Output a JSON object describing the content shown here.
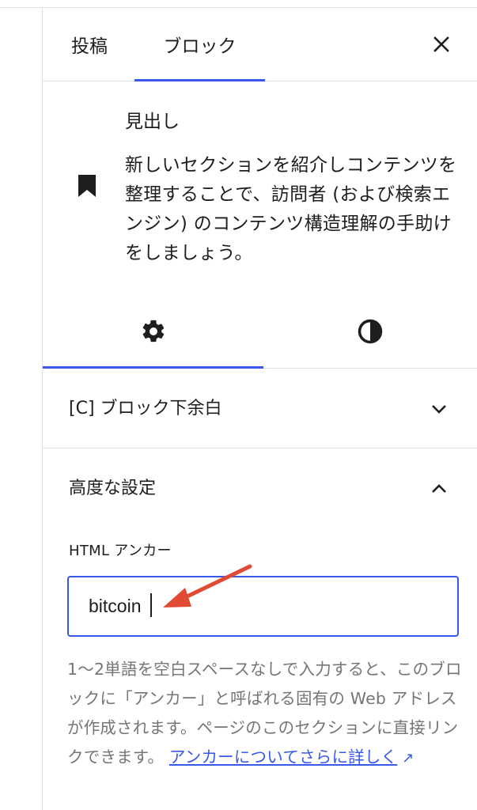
{
  "tabs": {
    "post_label": "投稿",
    "block_label": "ブロック",
    "close_icon": "close-icon"
  },
  "block": {
    "icon": "bookmark-icon",
    "title": "見出し",
    "description": "新しいセクションを紹介しコンテンツを整理することで、訪問者 (および検索エンジン) のコンテンツ構造理解の手助けをしましょう。"
  },
  "subtabs": {
    "settings_icon": "gear-icon",
    "styles_icon": "contrast-icon"
  },
  "sections": {
    "margin_label": "[C] ブロック下余白",
    "margin_state": "collapsed",
    "advanced_label": "高度な設定",
    "advanced_state": "expanded"
  },
  "anchor": {
    "label": "HTML アンカー",
    "value": "bitcoin"
  },
  "help": {
    "text": "1〜2単語を空白スペースなしで入力すると、このブロックに「アンカー」と呼ばれる固有の Web アドレスが作成されます。ページのこのセクションに直接リンクできます。",
    "link_text": "アンカーについてさらに詳しく",
    "link_icon": "external-arrow-icon"
  },
  "colors": {
    "accent": "#3858e9",
    "annotation_arrow": "#e24a33",
    "help_text": "#757575"
  }
}
